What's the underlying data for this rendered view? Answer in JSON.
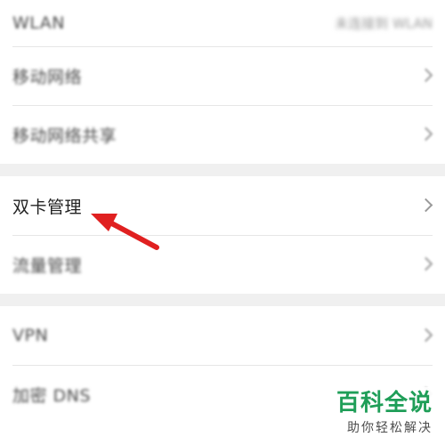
{
  "settings": {
    "group1": [
      {
        "label": "WLAN",
        "value": "未连接到 WLAN"
      },
      {
        "label": "移动网络"
      },
      {
        "label": "移动网络共享"
      }
    ],
    "group2": [
      {
        "label": "双卡管理"
      },
      {
        "label": "流量管理"
      }
    ],
    "group3": [
      {
        "label": "VPN"
      },
      {
        "label": "加密 DNS"
      }
    ]
  },
  "annotation": {
    "arrow_color": "#e02020",
    "target": "双卡管理"
  },
  "watermark": {
    "title": "百科全说",
    "subtitle": "助你轻松解决"
  }
}
